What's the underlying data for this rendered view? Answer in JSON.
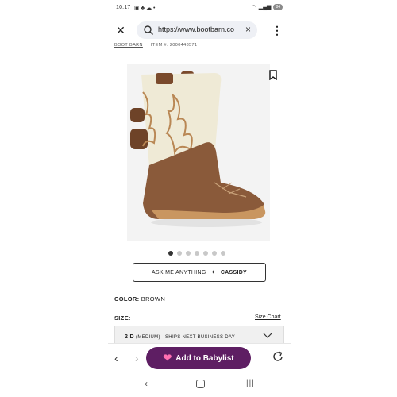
{
  "status_bar": {
    "time": "10:17",
    "battery": "84"
  },
  "browser": {
    "url": "https://www.bootbarn.co",
    "close_icon": "close-icon",
    "menu_icon": "kebab-icon"
  },
  "breadcrumb": {
    "brand": "BOOT BARN",
    "item": "ITEM #: 2000448571"
  },
  "product": {
    "ask_label": "ASK ME ANYTHING",
    "assistant_name": "CASSIDY",
    "color_label": "COLOR:",
    "color_value": "BROWN",
    "size_label": "SIZE:",
    "size_chart": "Size Chart",
    "size_selected": "2 D",
    "size_detail": "(MEDIUM) - SHIPS NEXT BUSINESS DAY",
    "image_count": 7,
    "active_image": 1
  },
  "bottom_bar": {
    "babylist_label": "Add to Babylist"
  },
  "colors": {
    "babylist": "#5e1e63",
    "heart": "#ff6fb1"
  }
}
